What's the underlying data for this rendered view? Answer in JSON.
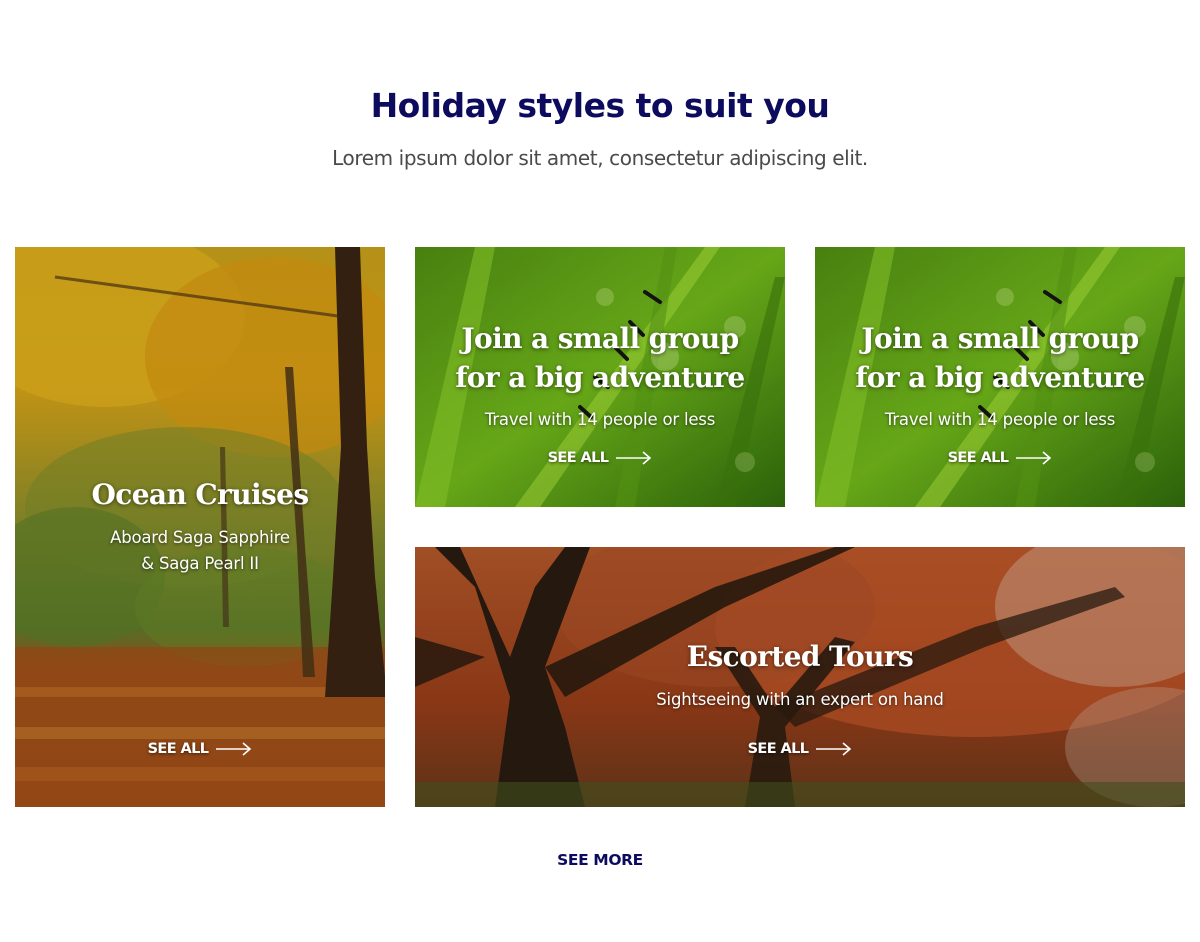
{
  "section": {
    "title": "Holiday styles to suit you",
    "subtitle": "Lorem ipsum dolor sit amet, consectetur adipiscing elit."
  },
  "cards": [
    {
      "title": "Ocean Cruises",
      "subtitle": "Aboard Saga Sapphire\n& Saga Pearl II",
      "link_label": "SEE ALL",
      "image": "autumn-forest-path"
    },
    {
      "title": "Join a small group\nfor a big adventure",
      "subtitle": "Travel with 14 people or less",
      "link_label": "SEE ALL",
      "image": "ants-on-grass"
    },
    {
      "title": "Join a small group\nfor a big adventure",
      "subtitle": "Travel with 14 people or less",
      "link_label": "SEE ALL",
      "image": "ants-on-grass"
    },
    {
      "title": "Escorted Tours",
      "subtitle": "Sightseeing with an expert on hand",
      "link_label": "SEE ALL",
      "image": "red-autumn-tree"
    }
  ],
  "footer": {
    "see_more_label": "SEE MORE"
  },
  "icons": {
    "arrow": "arrow-right-icon"
  },
  "colors": {
    "heading": "#0d0b5e",
    "body_text": "#4a4a4a",
    "card_text": "#ffffff"
  }
}
